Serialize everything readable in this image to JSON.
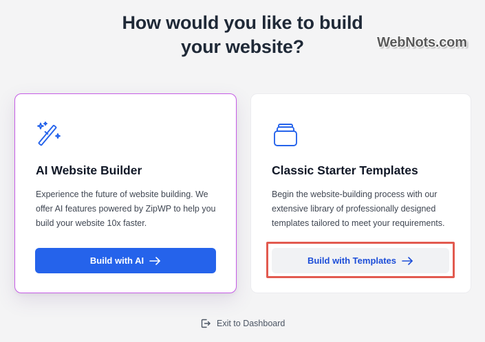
{
  "heading": {
    "line1": "How would you like to build",
    "line2": "your website?"
  },
  "watermark": "WebNots.com",
  "cards": {
    "ai": {
      "icon": "magic-wand-icon",
      "title": "AI Website Builder",
      "description": "Experience the future of website building. We offer AI features powered by ZipWP to help you build your website 10x faster.",
      "button_label": "Build with AI",
      "button_icon": "arrow-right-icon"
    },
    "templates": {
      "icon": "template-stack-icon",
      "title": "Classic Starter Templates",
      "description": "Begin the website-building process with our extensive library of professionally designed templates tailored to meet your requirements.",
      "button_label": "Build with Templates",
      "button_icon": "arrow-right-icon"
    }
  },
  "footer": {
    "exit_label": "Exit to Dashboard",
    "exit_icon": "exit-door-icon"
  },
  "colors": {
    "primary": "#2563eb",
    "ai_card_border": "#c65ce6",
    "highlight": "#e25a4f",
    "background": "#f4f4f5"
  }
}
